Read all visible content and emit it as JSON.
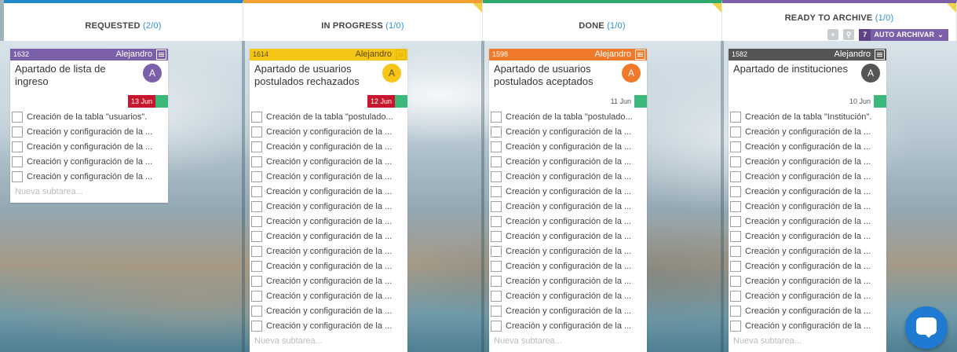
{
  "columns": [
    {
      "title": "REQUESTED",
      "count": "(2/0)",
      "accent": "#1f86c8",
      "card": {
        "id": "1632",
        "user": "Alejandro",
        "header_color": "#7b5fa8",
        "title": "Apartado de lista de ingreso",
        "avatar_letter": "A",
        "avatar_color": "#7b5fa8",
        "date": "13 Jun",
        "date_bg": "#c7172c",
        "date_color": "#ffffff",
        "subtasks": [
          "Creación de la tabla \"usuarios\".",
          "Creación y configuración de la ...",
          "Creación y configuración de la ...",
          "Creación y configuración de la ...",
          "Creación y configuración de la ..."
        ],
        "new_subtask_placeholder": "Nueva subtarea..."
      }
    },
    {
      "title": "IN PROGRESS",
      "count": "(1/0)",
      "accent": "#f0a030",
      "card": {
        "id": "1614",
        "user": "Alejandro",
        "header_color": "#f5c518",
        "title": "Apartado de usuarios postulados rechazados",
        "avatar_letter": "A",
        "avatar_color": "#f5c518",
        "date": "12 Jun",
        "date_bg": "#c7172c",
        "date_color": "#ffffff",
        "subtasks": [
          "Creación de la tabla \"postulado...",
          "Creación y configuración de la ...",
          "Creación y configuración de la ...",
          "Creación y configuración de la ...",
          "Creación y configuración de la ...",
          "Creación y configuración de la ...",
          "Creación y configuración de la ...",
          "Creación y configuración de la ...",
          "Creación y configuración de la ...",
          "Creación y configuración de la ...",
          "Creación y configuración de la ...",
          "Creación y configuración de la ...",
          "Creación y configuración de la ...",
          "Creación y configuración de la ...",
          "Creación y configuración de la ..."
        ],
        "new_subtask_placeholder": "Nueva subtarea..."
      }
    },
    {
      "title": "DONE",
      "count": "(1/0)",
      "accent": "#2eaa6e",
      "card": {
        "id": "1598",
        "user": "Alejandro",
        "header_color": "#f07a2a",
        "title": "Apartado de usuarios postulados aceptados",
        "avatar_letter": "A",
        "avatar_color": "#f07a2a",
        "date": "11 Jun",
        "date_bg": "#ffffff",
        "date_color": "#555555",
        "subtasks": [
          "Creación de la tabla \"postulado...",
          "Creación y configuración de la ...",
          "Creación y configuración de la ...",
          "Creación y configuración de la ...",
          "Creación y configuración de la ...",
          "Creación y configuración de la ...",
          "Creación y configuración de la ...",
          "Creación y configuración de la ...",
          "Creación y configuración de la ...",
          "Creación y configuración de la ...",
          "Creación y configuración de la ...",
          "Creación y configuración de la ...",
          "Creación y configuración de la ...",
          "Creación y configuración de la ...",
          "Creación y configuración de la ..."
        ],
        "new_subtask_placeholder": "Nueva subtarea..."
      }
    },
    {
      "title": "READY TO ARCHIVE",
      "count": "(1/0)",
      "accent": "#7b5fa8",
      "auto_archive_label": "AUTO ARCHIVAR",
      "auto_archive_days": "7",
      "card": {
        "id": "1582",
        "user": "Alejandro",
        "header_color": "#555555",
        "title": "Apartado de instituciones",
        "avatar_letter": "A",
        "avatar_color": "#555555",
        "date": "10 Jun",
        "date_bg": "#ffffff",
        "date_color": "#555555",
        "subtasks": [
          "Creación de la tabla \"Institución\".",
          "Creación y configuración de la ...",
          "Creación y configuración de la ...",
          "Creación y configuración de la ...",
          "Creación y configuración de la ...",
          "Creación y configuración de la ...",
          "Creación y configuración de la ...",
          "Creación y configuración de la ...",
          "Creación y configuración de la ...",
          "Creación y configuración de la ...",
          "Creación y configuración de la ...",
          "Creación y configuración de la ...",
          "Creación y configuración de la ...",
          "Creación y configuración de la ...",
          "Creación y configuración de la ..."
        ],
        "new_subtask_placeholder": "Nueva subtarea..."
      }
    }
  ],
  "icons": {
    "card_menu": "hamburger-menu-icon",
    "expand": "expand-icon",
    "search": "search-icon",
    "chevron": "chevron-down-icon",
    "chat": "chat-bubble-icon"
  }
}
